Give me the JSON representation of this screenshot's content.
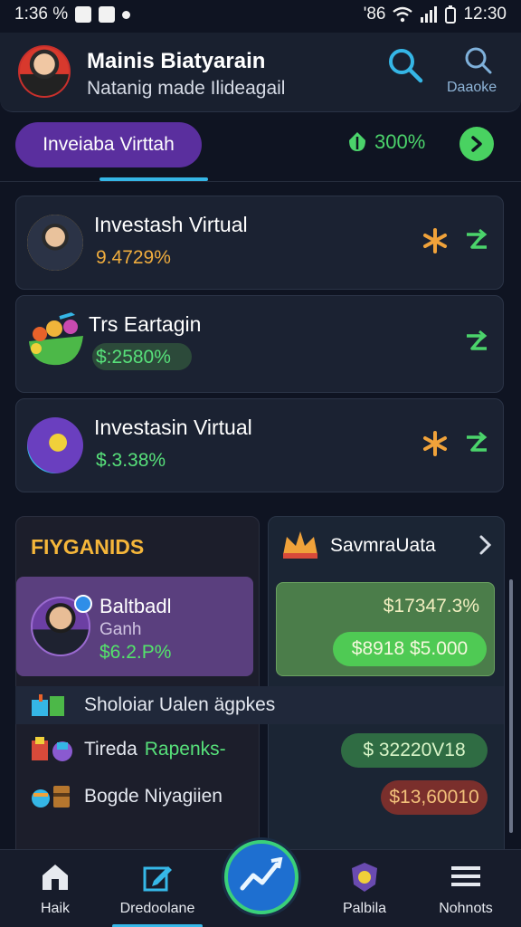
{
  "status_bar": {
    "time": "1:36 %",
    "right_time": "12:30",
    "signal_text": "'86"
  },
  "header": {
    "name": "Mainis Biatyarain",
    "subtitle": "Natanig made Ilideagail",
    "right_label": "Daaoke"
  },
  "subheader": {
    "pill_label": "Inveiaba Virttah",
    "percent": "300%"
  },
  "investments": [
    {
      "title": "Investash Virtual",
      "value": "9.4729%",
      "value_color": "#f0ad3e"
    },
    {
      "title": "Trs Eartagin",
      "value": "$:2580%",
      "value_color": "#57e07a"
    },
    {
      "title": "Investasin Virtual",
      "value": "$.3.38%",
      "value_color": "#57e07a"
    }
  ],
  "left_panel": {
    "title": "FIYGANIDS",
    "profile": {
      "name": "Baltbadl",
      "sub": "Ganh",
      "value": "$6.2.P%"
    }
  },
  "right_panel": {
    "title": "SavmraUata",
    "value_top": "$17347.3%",
    "value_pill": "$8918 $5.000"
  },
  "rows": [
    {
      "label": "Sholoiar Ualen ägpkes"
    },
    {
      "label_a": "Tireda",
      "label_b": "Rapenks-",
      "pill": "$ 32220V18",
      "pill_bg": "#2f6c43",
      "pill_color": "#d9f5c8"
    },
    {
      "label": "Bogde Niyagiien",
      "pill": "$13,60010",
      "pill_bg": "#7a2f2c",
      "pill_color": "#f2c07a"
    }
  ],
  "bottom_nav": [
    {
      "label": "Haik"
    },
    {
      "label": "Dredoolane"
    },
    {
      "label": "Palbila"
    },
    {
      "label": "Nohnots"
    }
  ],
  "colors": {
    "accent_green": "#4bd36b",
    "accent_blue": "#35b6e6",
    "pill_purple": "#5a2f9e",
    "gold": "#f5b63a"
  }
}
